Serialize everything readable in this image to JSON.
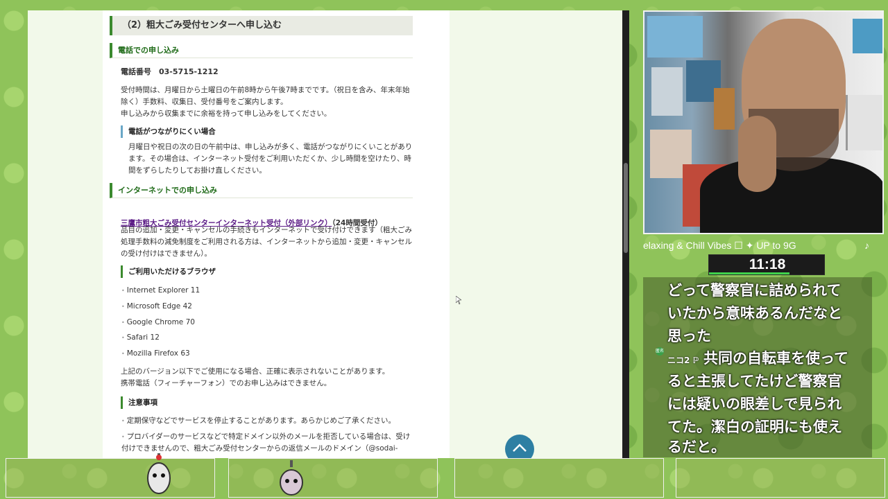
{
  "page": {
    "heading": "（2）粗大ごみ受付センターへ申し込む",
    "phone_section": {
      "heading": "電話での申し込み",
      "phone_label": "電話番号　03-5715-1212",
      "hours_text": "受付時間は、月曜日から土曜日の午前8時から午後7時までです。（祝日を含み、年末年始\n除く）手数料、収集日、受付番号をご案内します。\n申し込みから収集までに余裕を持って申し込みをしてください。",
      "sub_heading": "電話がつながりにくい場合",
      "sub_text": "月曜日や祝日の次の日の午前中は、申し込みが多く、電話がつながりにくいことがあり\nます。その場合は、インターネット受付をご利用いただくか、少し時間を空けたり、時\n間をずらしたりしてお掛け直しください。"
    },
    "internet_section": {
      "heading": "インターネットでの申し込み",
      "link_text": "三鷹市粗大ごみ受付センターインターネット受付（外部リンク）",
      "link_suffix": "（24時間受付）",
      "body_text": "品目の追加・変更・キャンセルの手続きもインターネットで受け付けできます（粗大ごみ\n処理手数料の減免制度をご利用される方は、インターネットから追加・変更・キャンセル\nの受け付けはできません）。",
      "browsers_heading": "ご利用いただけるブラウザ",
      "browsers": [
        "Internet Explorer 11",
        "Microsoft Edge 42",
        "Google Chrome 70",
        "Safari 12",
        "Mozilla Firefox 63"
      ],
      "browsers_note": "上記のバージョン以下でご使用になる場合、正確に表示されないことがあります。\n携帯電話（フィーチャーフォン）でのお申し込みはできません。",
      "notes_heading": "注意事項",
      "notes": [
        "定期保守などでサービスを停止することがあります。あらかじめご了承ください。",
        "プロバイダーのサービスなどで特定ドメイン以外のメールを拒否している場合は、受け\n付けできませんので、粗大ごみ受付センターからの返信メールのドメイン（@sodai-"
      ]
    },
    "back_to_top_icon": "chevron-up-icon"
  },
  "overlay": {
    "ticker": "elaxing & Chill Vibes ☐ ✦ UP to 9G",
    "ticker_note": "♪",
    "clock": "11:18",
    "clock_progress": 0.7,
    "chat_lines_1": [
      "どって警察官に詰められて",
      "いたから意味あるんだなと",
      "思った"
    ],
    "chat_user": "ニコ2 ℙ",
    "chat_badge": "匿名",
    "chat_lines_2": [
      "共同の自転車を使って"
    ],
    "chat_lines_3": [
      "ると主張してたけど警察官",
      "には疑いの眼差しで見られ",
      "てた。潔白の証明にも使え",
      "るだと。"
    ]
  },
  "colors": {
    "accent_green": "#3b8a2e",
    "heading_green": "#1f6b18",
    "link_purple": "#5b1b86",
    "top_button": "#2e7fa3",
    "clock_bar": "#3fd24c"
  }
}
